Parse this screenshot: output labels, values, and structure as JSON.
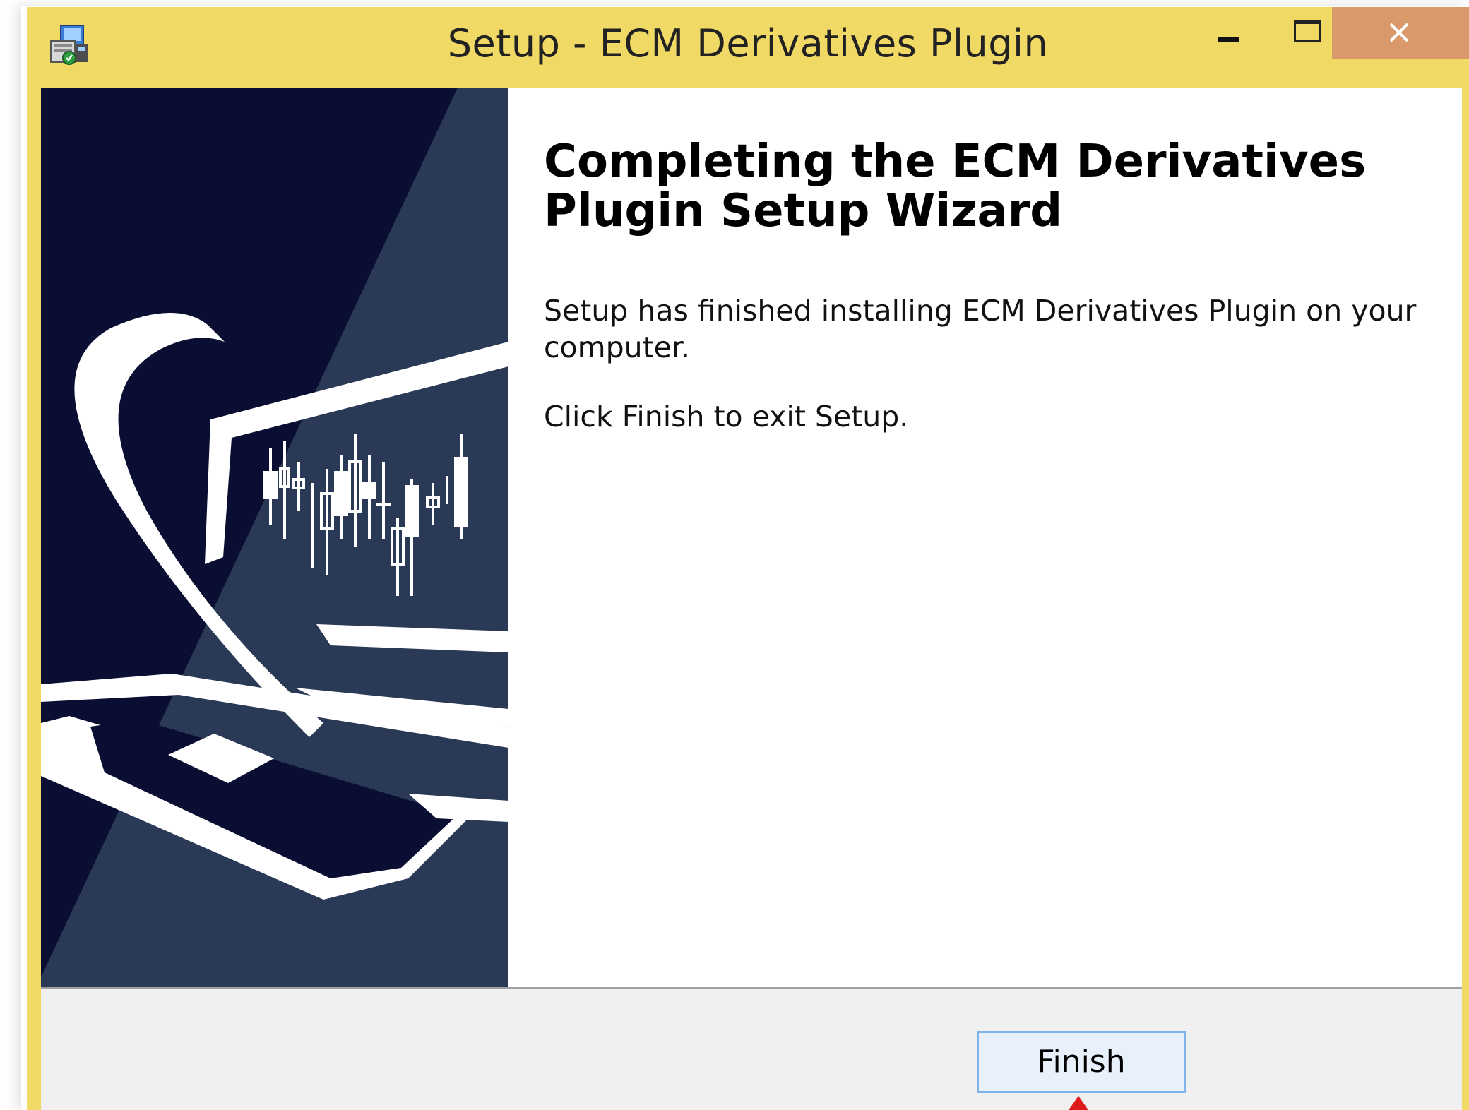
{
  "window": {
    "title": "Setup - ECM Derivatives Plugin",
    "titlebar_color": "#f0d965",
    "close_button_color": "#d9996a"
  },
  "titlebar": {
    "app_icon": "setup-installer-icon",
    "buttons": [
      {
        "name": "minimize",
        "icon": "minimize-icon"
      },
      {
        "name": "maximize",
        "icon": "maximize-icon"
      },
      {
        "name": "close",
        "icon": "close-icon"
      }
    ]
  },
  "wizard": {
    "side_image": "monitor-candlestick-chart-illustration",
    "heading": "Completing the ECM Derivatives Plugin Setup Wizard",
    "message": "Setup has finished installing ECM Derivatives Plugin on your computer.",
    "instruction": "Click Finish to exit Setup."
  },
  "buttons": {
    "finish_label": "Finish"
  },
  "annotation": {
    "pointer_color": "#e01a1a"
  }
}
